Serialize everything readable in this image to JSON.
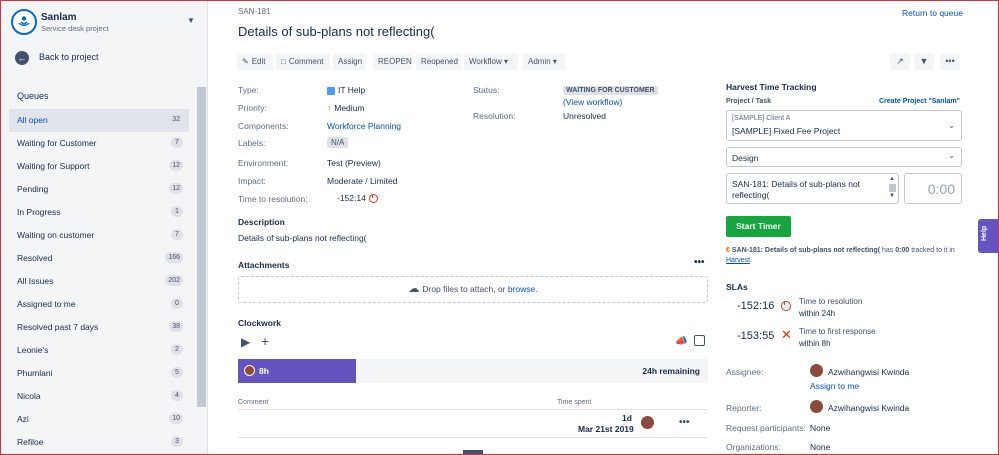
{
  "project": {
    "name": "Sanlam",
    "subtitle": "Service desk project"
  },
  "nav": {
    "back_label": "Back to project",
    "queues_title": "Queues"
  },
  "queues": [
    {
      "label": "All open",
      "count": "32"
    },
    {
      "label": "Waiting for Customer",
      "count": "7"
    },
    {
      "label": "Waiting for Support",
      "count": "12"
    },
    {
      "label": "Pending",
      "count": "12"
    },
    {
      "label": "In Progress",
      "count": "1"
    },
    {
      "label": "Waiting on customer",
      "count": "7"
    },
    {
      "label": "Resolved",
      "count": "166"
    },
    {
      "label": "All Issues",
      "count": "202"
    },
    {
      "label": "Assigned to me",
      "count": "0"
    },
    {
      "label": "Resolved past 7 days",
      "count": "38"
    },
    {
      "label": "Leonie's",
      "count": "2"
    },
    {
      "label": "Phumlani",
      "count": "5"
    },
    {
      "label": "Nicola",
      "count": "4"
    },
    {
      "label": "Azi",
      "count": "10"
    },
    {
      "label": "Refiloe",
      "count": "3"
    }
  ],
  "issue": {
    "key": "SAN-181",
    "title": "Details of sub-plans not reflecting(",
    "return_label": "Return to queue"
  },
  "toolbar": {
    "edit": "Edit",
    "comment": "Comment",
    "assign": "Assign",
    "reopen": "REOPEN",
    "reopened": "Reopened",
    "workflow": "Workflow",
    "admin": "Admin"
  },
  "details": {
    "type_label": "Type:",
    "type_value": "IT Help",
    "priority_label": "Priority:",
    "priority_value": "Medium",
    "components_label": "Components:",
    "components_value": "Workforce Planning",
    "labels_label": "Labels:",
    "labels_value": "N/A",
    "environment_label": "Environment:",
    "environment_value": "Test (Preview)",
    "impact_label": "Impact:",
    "impact_value": "Moderate / Limited",
    "ttr_label": "Time to resolution:",
    "ttr_value": "-152:14",
    "status_label": "Status:",
    "status_value": "WAITING FOR CUSTOMER",
    "view_workflow": "(View workflow)",
    "resolution_label": "Resolution:",
    "resolution_value": "Unresolved"
  },
  "description": {
    "title": "Description",
    "text": "Details of sub-plans not reflecting("
  },
  "attachments": {
    "title": "Attachments",
    "drop_text": "Drop files to attach, or",
    "browse": "browse."
  },
  "clockwork": {
    "title": "Clockwork",
    "logged": "8h",
    "remaining": "24h remaining",
    "logged_fraction": 0.25,
    "col_comment": "Comment",
    "col_time": "Time spent",
    "entry_duration": "1d",
    "entry_date": "Mar 21st 2019"
  },
  "harvest": {
    "title": "Harvest Time Tracking",
    "project_task": "Project / Task",
    "create_project": "Create Project \"Sanlam\"",
    "client": "[SAMPLE] Client A",
    "project": "[SAMPLE] Fixed Fee Project",
    "task": "Design",
    "notes": "SAN-181: Details of sub-plans not reflecting(",
    "timer": "0:00",
    "start_timer": "Start Timer",
    "note_bold": "SAN-181: Details of sub-plans not reflecting(",
    "note_rest_1": "has",
    "note_hours": "0:00",
    "note_rest_2": "tracked to it in",
    "note_link": "Harvest"
  },
  "slas": {
    "title": "SLAs",
    "items": [
      {
        "time": "-152:16",
        "name": "Time to resolution",
        "goal": "within 24h"
      },
      {
        "time": "-153:55",
        "name": "Time to first response",
        "goal": "within 8h"
      }
    ]
  },
  "people": {
    "assignee_label": "Assignee:",
    "assignee": "Azwihangwisi Kwinda",
    "assign_to_me": "Assign to me",
    "reporter_label": "Reporter:",
    "reporter": "Azwihangwisi Kwinda",
    "participants_label": "Request participants:",
    "participants": "None",
    "organizations_label": "Organizations:",
    "organizations": "None"
  },
  "help_label": "Help",
  "colors": {
    "accent": "#0052cc",
    "clockwork": "#6554c0",
    "start_timer": "#16a63f",
    "breach": "#de350b"
  }
}
